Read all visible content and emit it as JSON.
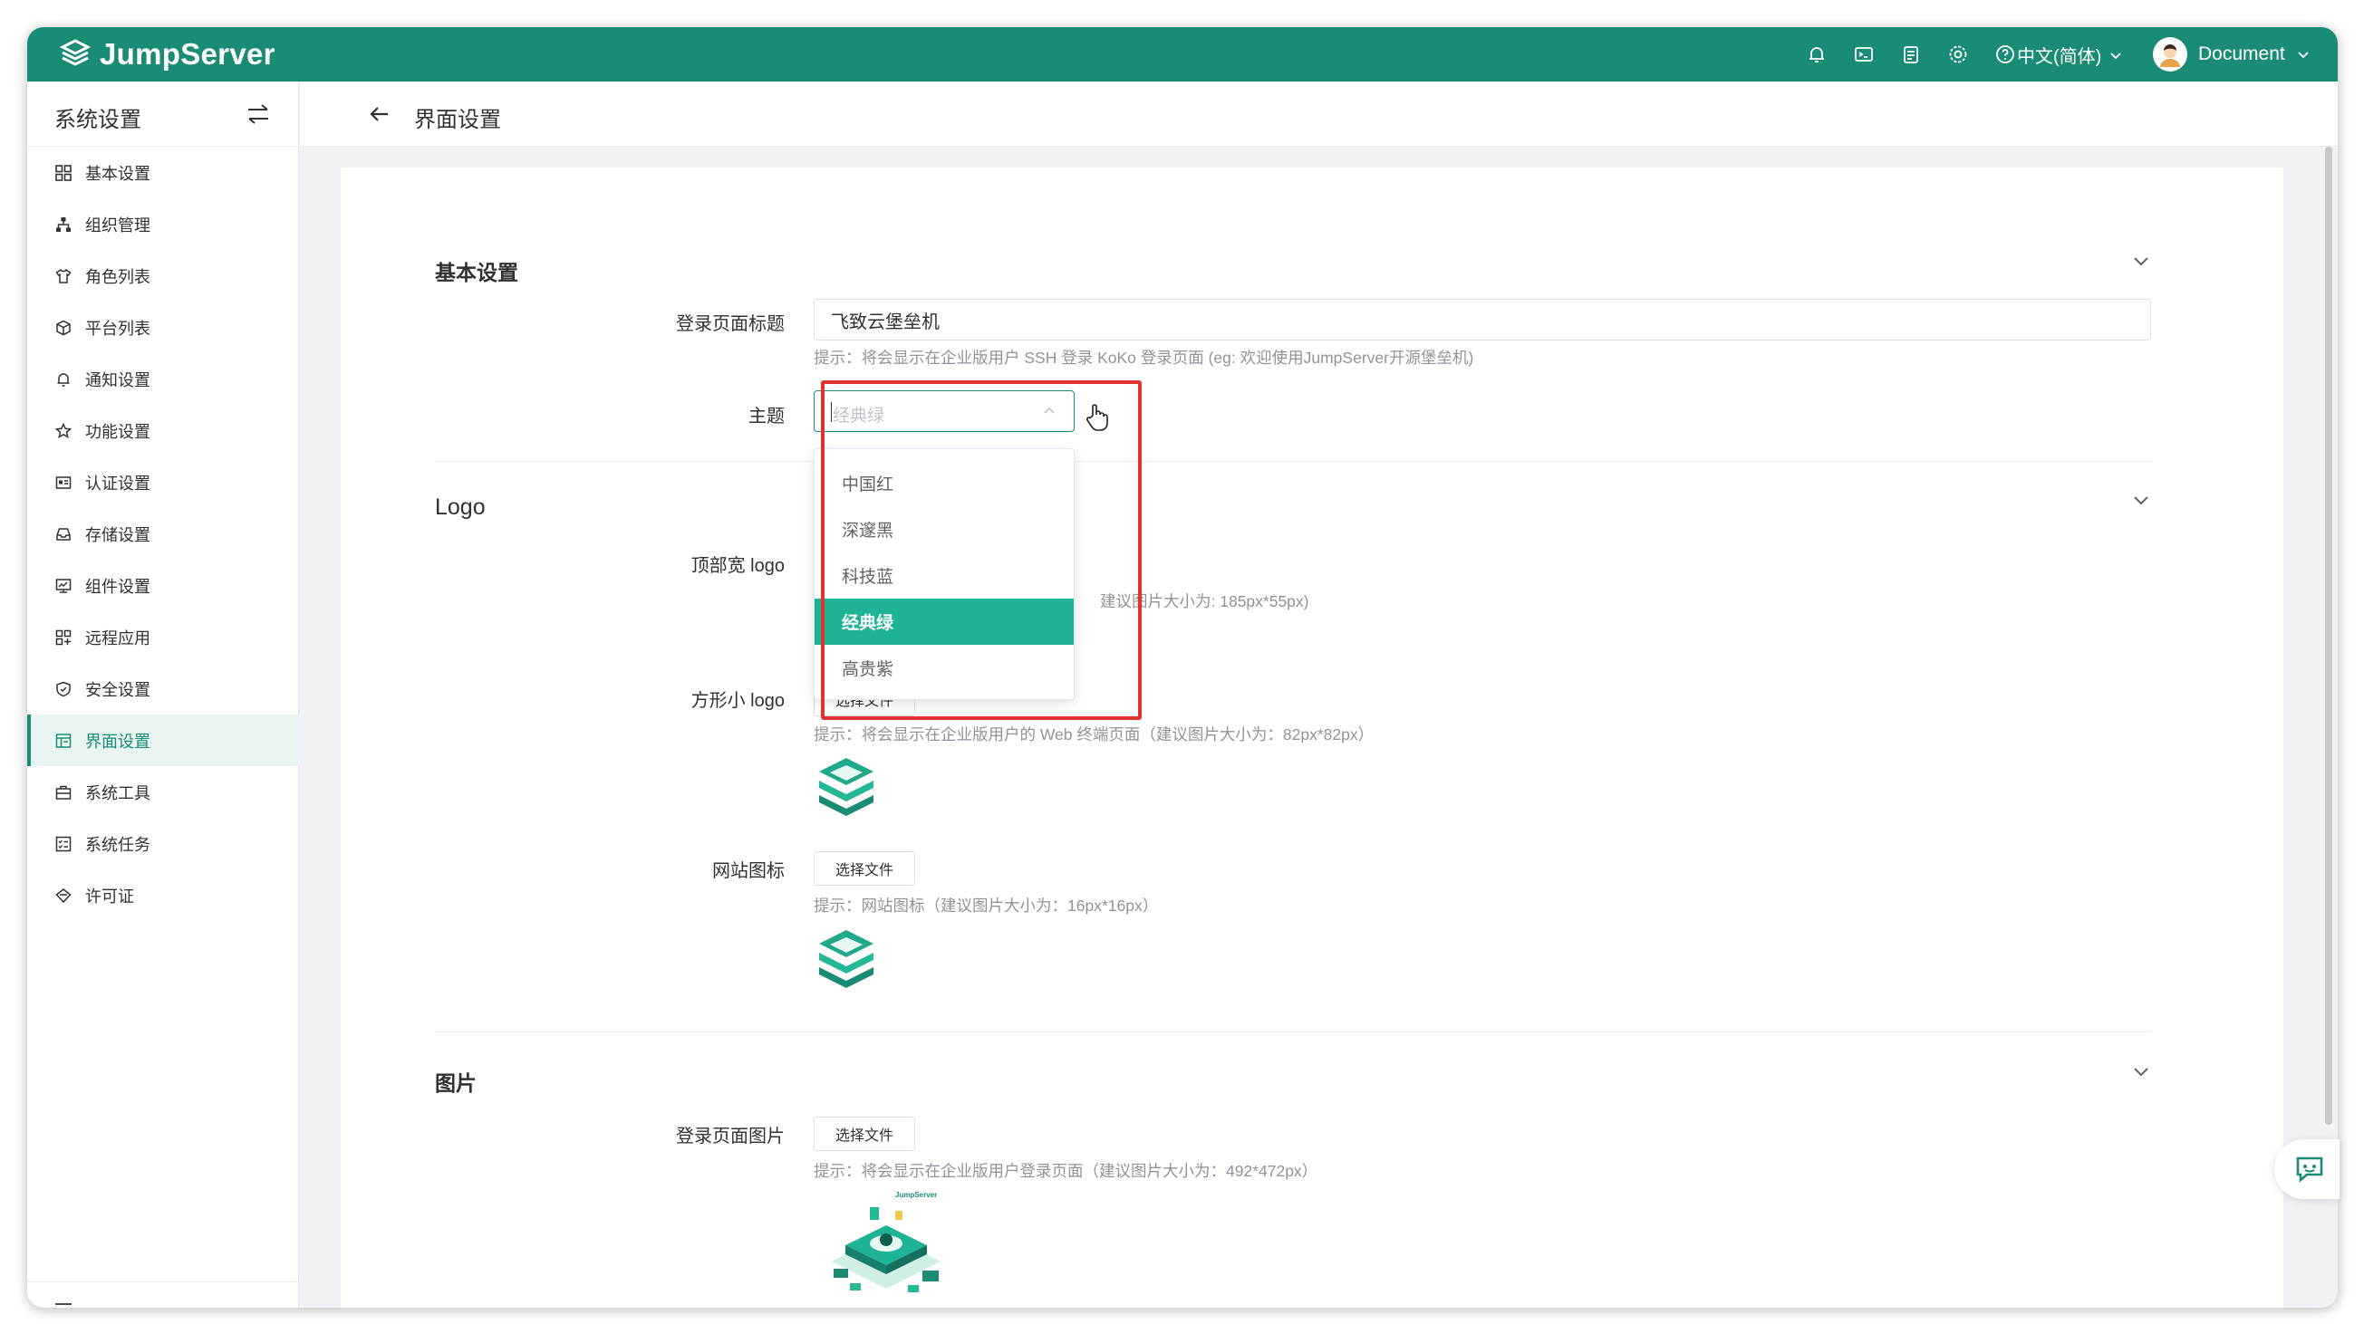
{
  "app": {
    "brand": "JumpServer"
  },
  "topbar": {
    "icons": [
      "bell-icon",
      "terminal-icon",
      "clipboard-icon",
      "gear-icon",
      "help-icon"
    ],
    "language": "中文(简体)",
    "user_name": "Document"
  },
  "sidebar": {
    "title": "系统设置",
    "items": [
      {
        "label": "基本设置",
        "icon": "grid-icon"
      },
      {
        "label": "组织管理",
        "icon": "org-tree-icon"
      },
      {
        "label": "角色列表",
        "icon": "shirt-icon"
      },
      {
        "label": "平台列表",
        "icon": "cube-icon"
      },
      {
        "label": "通知设置",
        "icon": "bell-icon"
      },
      {
        "label": "功能设置",
        "icon": "star-icon"
      },
      {
        "label": "认证设置",
        "icon": "id-card-icon"
      },
      {
        "label": "存储设置",
        "icon": "inbox-icon"
      },
      {
        "label": "组件设置",
        "icon": "monitor-icon"
      },
      {
        "label": "远程应用",
        "icon": "apps-icon"
      },
      {
        "label": "安全设置",
        "icon": "shield-icon"
      },
      {
        "label": "界面设置",
        "icon": "layout-icon",
        "active": true
      },
      {
        "label": "系统工具",
        "icon": "toolbox-icon"
      },
      {
        "label": "系统任务",
        "icon": "tasks-icon"
      },
      {
        "label": "许可证",
        "icon": "license-icon"
      }
    ]
  },
  "page": {
    "title": "界面设置"
  },
  "basic": {
    "title": "基本设置",
    "login_title_label": "登录页面标题",
    "login_title_value": "飞致云堡垒机",
    "login_title_hint": "提示：将会显示在企业版用户 SSH 登录 KoKo 登录页面 (eg: 欢迎使用JumpServer开源堡垒机)",
    "theme_label": "主题",
    "theme_placeholder": "经典绿",
    "theme_options": [
      "中国红",
      "深邃黑",
      "科技蓝",
      "经典绿",
      "高贵紫"
    ],
    "theme_selected": "经典绿"
  },
  "logo": {
    "title": "Logo",
    "wide_label": "顶部宽 logo",
    "wide_hint_tail": "建议图片大小为: 185px*55px)",
    "square_label": "方形小 logo",
    "square_button_partial": "选择文件",
    "square_hint": "提示：将会显示在企业版用户的 Web 终端页面（建议图片大小为：82px*82px）",
    "favicon_label": "网站图标",
    "favicon_button": "选择文件",
    "favicon_hint": "提示：网站图标（建议图片大小为：16px*16px）"
  },
  "image": {
    "title": "图片",
    "login_image_label": "登录页面图片",
    "login_image_button": "选择文件",
    "login_image_hint": "提示：将会显示在企业版用户登录页面（建议图片大小为：492*472px）",
    "preview_brand": "JumpServer"
  },
  "colors": {
    "primary": "#1a8c76",
    "selected_option": "#1fb395",
    "highlight_box": "#e0332f"
  }
}
